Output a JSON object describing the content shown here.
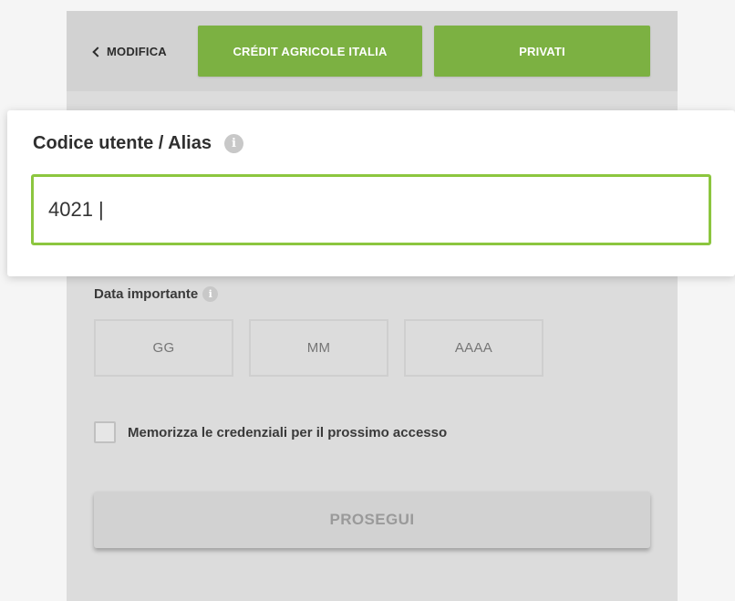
{
  "header": {
    "back_label": "MODIFICA",
    "bank_label": "CRÉDIT AGRICOLE ITALIA",
    "segment_label": "PRIVATI"
  },
  "user_field": {
    "label": "Codice utente / Alias",
    "value": "4021 |",
    "info_icon": "info-icon"
  },
  "date_field": {
    "label": "Data importante",
    "day_placeholder": "GG",
    "month_placeholder": "MM",
    "year_placeholder": "AAAA"
  },
  "remember": {
    "label": "Memorizza le credenziali per il prossimo accesso",
    "checked": false
  },
  "proceed_label": "PROSEGUI",
  "colors": {
    "accent_green": "#7cb142",
    "focus_border": "#8cc63f",
    "card_bg": "#dcdcdc"
  }
}
